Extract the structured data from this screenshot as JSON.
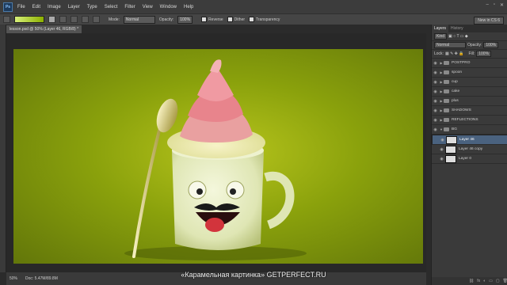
{
  "menu": {
    "ps_logo": "Ps",
    "items": [
      "File",
      "Edit",
      "Image",
      "Layer",
      "Type",
      "Select",
      "Filter",
      "View",
      "Window",
      "Help"
    ],
    "window_controls": [
      "–",
      "▫",
      "✕"
    ]
  },
  "options_bar": {
    "mode_label": "Mode:",
    "mode_value": "Normal",
    "opacity_label": "Opacity:",
    "opacity_value": "100%",
    "reverse_label": "Reverse",
    "dither_label": "Dither",
    "transparency_label": "Transparency",
    "workspace_label": "New in CS 6"
  },
  "document": {
    "tab_title": "lesson.psd @ 50% (Layer 46, RGB/8) *",
    "status_zoom": "50%",
    "status_doc": "Doc: 5.47M/89.8M",
    "caption": "«Карамельная картинка» GETPERFECT.RU"
  },
  "panel": {
    "tabs": [
      "Layers",
      "History"
    ],
    "kind_label": "Kind",
    "blend_mode": "Normal",
    "opacity_label": "Opacity:",
    "opacity_value": "100%",
    "lock_label": "Lock:",
    "fill_label": "Fill:",
    "fill_value": "100%",
    "layers": [
      {
        "name": "POSTPRO",
        "type": "group"
      },
      {
        "name": "spoon",
        "type": "group"
      },
      {
        "name": "cup",
        "type": "group"
      },
      {
        "name": "cake",
        "type": "group"
      },
      {
        "name": "plus",
        "type": "group"
      },
      {
        "name": "SHADOWS",
        "type": "group"
      },
      {
        "name": "REFLECTIONS",
        "type": "group"
      },
      {
        "name": "BG",
        "type": "group-open"
      },
      {
        "name": "Layer 46",
        "type": "layer",
        "selected": true
      },
      {
        "name": "Layer 46 copy",
        "type": "layer"
      },
      {
        "name": "Layer 0",
        "type": "layer"
      }
    ]
  },
  "colors": {
    "background_green": "#8aa10c",
    "selection_blue": "#4a627f",
    "cream": "#e9efc6",
    "pink": "#e8848c"
  }
}
